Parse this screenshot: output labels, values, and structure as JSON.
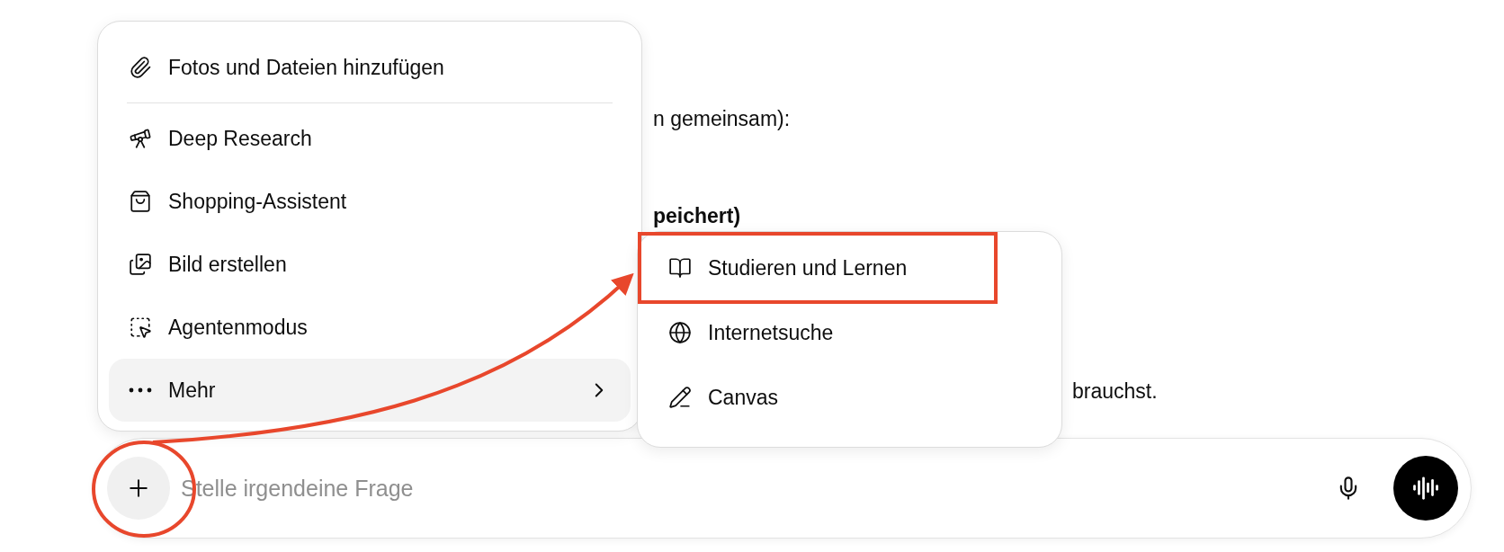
{
  "background_text": [
    {
      "right": "n gemeinsam):",
      "bold": false
    },
    {
      "right": "peichert)",
      "bold": true
    },
    {
      "far_right": "brauchst."
    }
  ],
  "menu": {
    "items": [
      {
        "kind": "attach",
        "label": "Fotos und Dateien hinzufügen",
        "selected": false,
        "divider_after": true
      },
      {
        "kind": "research",
        "label": "Deep Research",
        "selected": false
      },
      {
        "kind": "shopping",
        "label": "Shopping-Assistent",
        "selected": false
      },
      {
        "kind": "image",
        "label": "Bild erstellen",
        "selected": false
      },
      {
        "kind": "agent",
        "label": "Agentenmodus",
        "selected": false
      },
      {
        "kind": "more",
        "label": "Mehr",
        "selected": true,
        "submenu": true
      }
    ]
  },
  "submenu": {
    "items": [
      {
        "kind": "study",
        "label": "Studieren und Lernen",
        "highlighted": true
      },
      {
        "kind": "web",
        "label": "Internetsuche",
        "highlighted": false
      },
      {
        "kind": "canvas",
        "label": "Canvas",
        "highlighted": false
      }
    ]
  },
  "composer": {
    "placeholder": "Stelle irgendeine Frage"
  }
}
